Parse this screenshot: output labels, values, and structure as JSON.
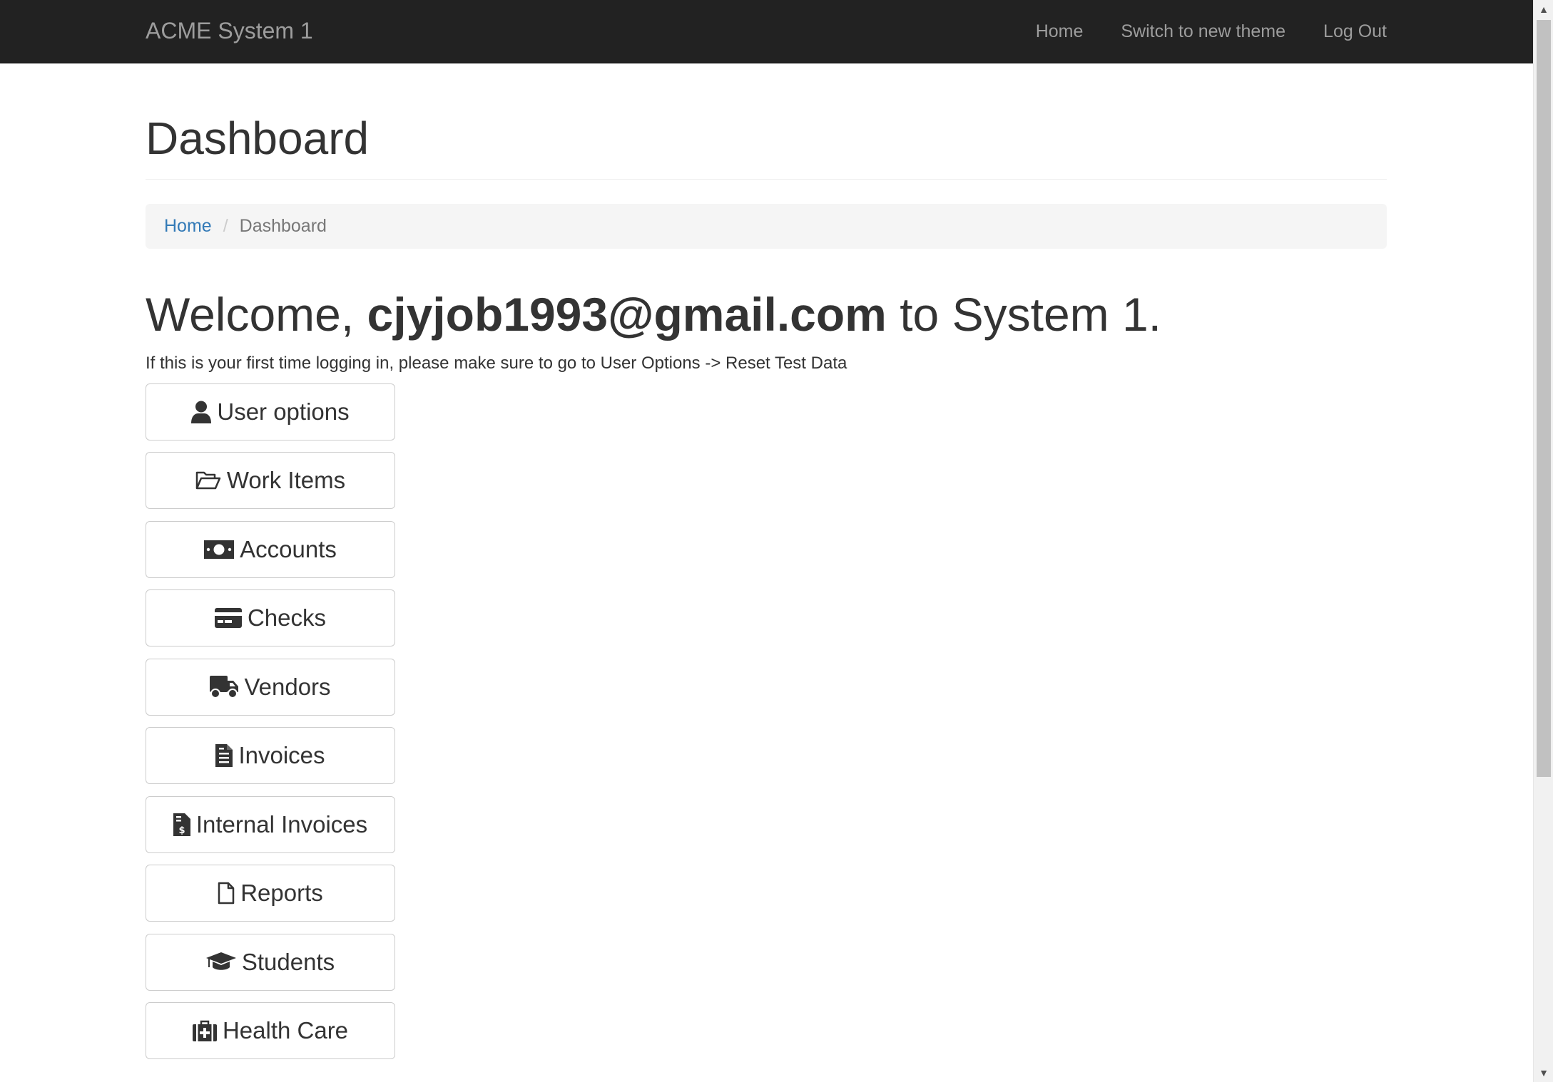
{
  "navbar": {
    "brand": "ACME System 1",
    "links": [
      {
        "label": "Home"
      },
      {
        "label": "Switch to new theme"
      },
      {
        "label": "Log Out"
      }
    ]
  },
  "page": {
    "title": "Dashboard"
  },
  "breadcrumb": {
    "home": "Home",
    "separator": "/",
    "current": "Dashboard"
  },
  "welcome": {
    "prefix": "Welcome,",
    "user": "cjyjob1993@gmail.com",
    "suffix": "to System 1.",
    "note": "If this is your first time logging in, please make sure to go to User Options -> Reset Test Data"
  },
  "menu": [
    {
      "label": "User options",
      "icon": "user-icon"
    },
    {
      "label": "Work Items",
      "icon": "folder-open-icon"
    },
    {
      "label": "Accounts",
      "icon": "money-bill-icon"
    },
    {
      "label": "Checks",
      "icon": "credit-card-icon"
    },
    {
      "label": "Vendors",
      "icon": "truck-icon"
    },
    {
      "label": "Invoices",
      "icon": "invoice-icon"
    },
    {
      "label": "Internal Invoices",
      "icon": "file-invoice-dollar-icon"
    },
    {
      "label": "Reports",
      "icon": "file-icon"
    },
    {
      "label": "Students",
      "icon": "graduation-cap-icon"
    },
    {
      "label": "Health Care",
      "icon": "medkit-icon"
    }
  ],
  "colors": {
    "navbar_bg": "#222222",
    "navbar_text": "#9d9d9d",
    "link": "#337ab7",
    "breadcrumb_bg": "#f5f5f5"
  }
}
